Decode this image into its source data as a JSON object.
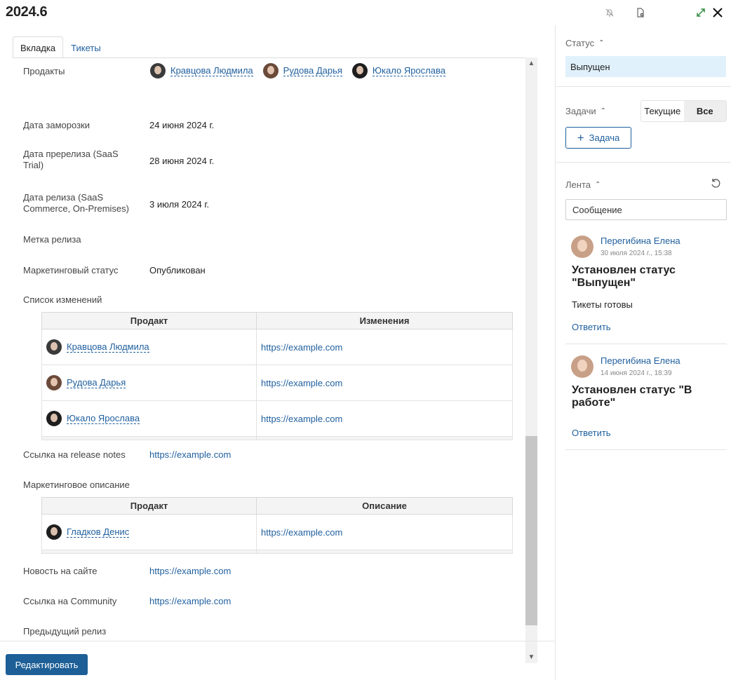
{
  "window": {
    "title": "2024.6"
  },
  "tabs": [
    {
      "label": "Вкладка"
    },
    {
      "label": "Тикеты"
    }
  ],
  "fields": {
    "products": {
      "label": "Продакты",
      "people": [
        {
          "name": "Кравцова Людмила"
        },
        {
          "name": "Рудова Дарья"
        },
        {
          "name": "Юкало Ярослава"
        }
      ]
    },
    "freeze_date": {
      "label": "Дата заморозки",
      "value": "24 июня 2024 г."
    },
    "prerelease_date": {
      "label": "Дата пререлиза (SaaS Trial)",
      "value": "28 июня 2024 г."
    },
    "release_date": {
      "label": "Дата релиза (SaaS Commerce, On-Premises)",
      "value": "3 июля 2024 г."
    },
    "release_tag": {
      "label": "Метка релиза",
      "value": ""
    },
    "marketing_status": {
      "label": "Маркетинговый статус",
      "value": "Опубликован"
    },
    "changelog": {
      "label": "Список изменений",
      "columns": [
        "Продакт",
        "Изменения"
      ],
      "rows": [
        {
          "person": "Кравцова Людмила",
          "link": "https://example.com"
        },
        {
          "person": "Рудова Дарья",
          "link": "https://example.com"
        },
        {
          "person": "Юкало Ярослава",
          "link": "https://example.com"
        }
      ]
    },
    "release_notes": {
      "label": "Ссылка на release notes",
      "value": "https://example.com"
    },
    "marketing_desc": {
      "label": "Маркетинговое описание",
      "columns": [
        "Продакт",
        "Описание"
      ],
      "rows": [
        {
          "person": "Гладков Денис",
          "link": "https://example.com"
        }
      ]
    },
    "site_news": {
      "label": "Новость на сайте",
      "value": "https://example.com"
    },
    "community": {
      "label": "Ссылка на Community",
      "value": "https://example.com"
    },
    "prev_release": {
      "label": "Предыдущий релиз",
      "value": ""
    }
  },
  "footer": {
    "edit_label": "Редактировать"
  },
  "sidebar": {
    "status": {
      "heading": "Статус",
      "value": "Выпущен"
    },
    "tasks": {
      "heading": "Задачи",
      "filter_current": "Текущие",
      "filter_all": "Все",
      "add_label": "Задача"
    },
    "feed": {
      "heading": "Лента",
      "message_placeholder": "Сообщение",
      "posts": [
        {
          "author": "Перегибина Елена",
          "time": "30 июля 2024 г., 15:38",
          "headline": "Установлен статус \"Выпущен\"",
          "body": "Тикеты готовы",
          "reply": "Ответить"
        },
        {
          "author": "Перегибина Елена",
          "time": "14 июня 2024 г., 18:39",
          "headline": "Установлен статус \"В работе\"",
          "body": "",
          "reply": "Ответить"
        }
      ]
    }
  },
  "icons": [
    "bell-off-icon",
    "document-settings-icon",
    "expand-icon",
    "close-icon",
    "refresh-icon",
    "plus-icon"
  ],
  "colors": {
    "accent": "#1f5f9e",
    "primary_button": "#1d5f96",
    "status_bg": "#e0f1fb"
  }
}
